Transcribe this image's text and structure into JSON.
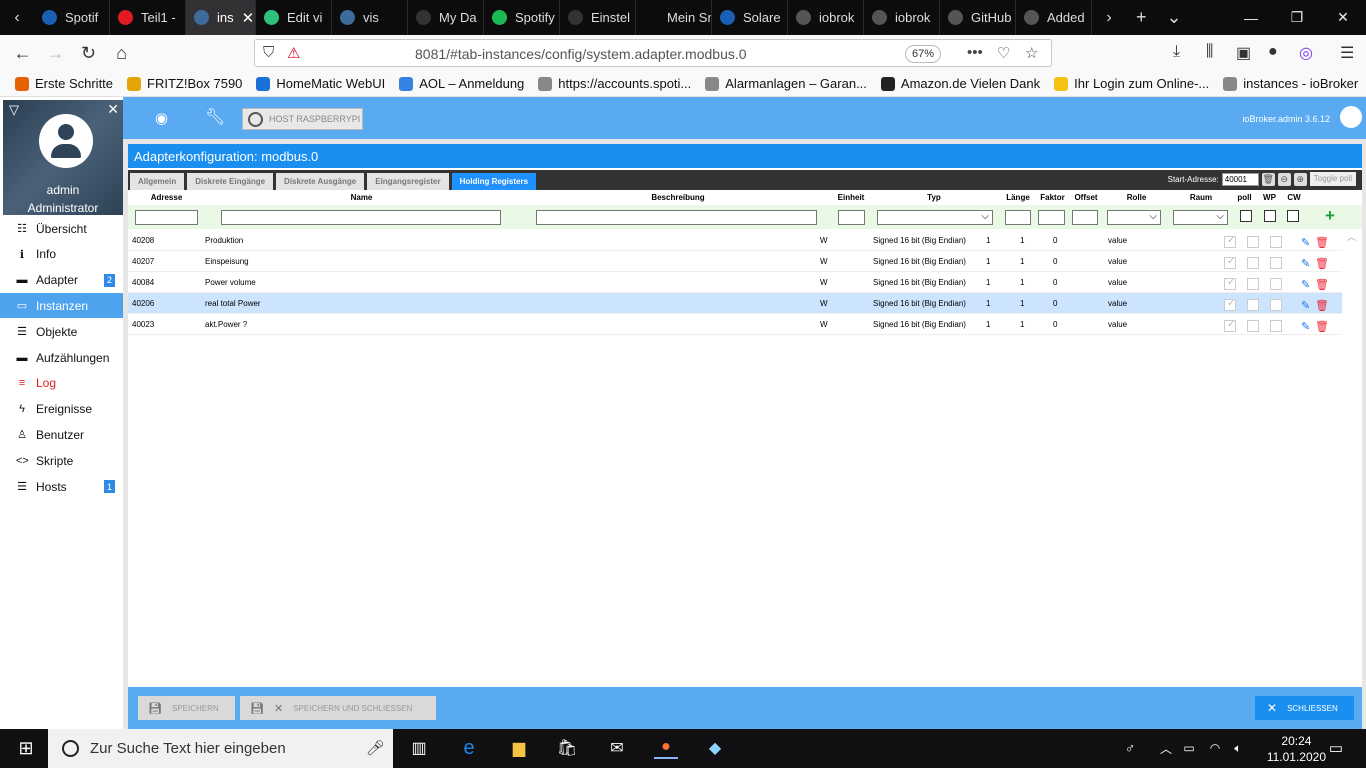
{
  "browser": {
    "tabs": [
      {
        "label": "Spotif",
        "color": "#1a5fb4"
      },
      {
        "label": "Teil1 -",
        "color": "#e01b24"
      },
      {
        "label": "ins",
        "color": "#3d6c9a",
        "active": true
      },
      {
        "label": "Edit vi",
        "color": "#2ec27e"
      },
      {
        "label": "vis",
        "color": "#3d6c9a"
      },
      {
        "label": "My Da",
        "color": "#333"
      },
      {
        "label": "Spotify",
        "color": "#1db954"
      },
      {
        "label": "Einstel",
        "color": "#333"
      },
      {
        "label": "Mein Smar",
        "color": "#0c0c0d"
      },
      {
        "label": "Solare",
        "color": "#1a5fb4"
      },
      {
        "label": "iobrok",
        "color": "#555"
      },
      {
        "label": "iobrok",
        "color": "#555"
      },
      {
        "label": "GitHub",
        "color": "#555"
      },
      {
        "label": "Added",
        "color": "#555"
      }
    ],
    "url": "8081/#tab-instances/config/system.adapter.modbus.0",
    "zoom": "67%",
    "bookmarks": [
      {
        "label": "Erste Schritte",
        "color": "#e66100"
      },
      {
        "label": "FRITZ!Box 7590",
        "color": "#e5a50a"
      },
      {
        "label": "HomeMatic WebUI",
        "color": "#1c71d8"
      },
      {
        "label": "AOL – Anmeldung",
        "color": "#3584e4"
      },
      {
        "label": "https://accounts.spoti...",
        "color": "#888"
      },
      {
        "label": "Alarmanlagen – Garan...",
        "color": "#888"
      },
      {
        "label": "Amazon.de Vielen Dank",
        "color": "#222"
      },
      {
        "label": "Ihr Login zum Online-...",
        "color": "#f5c211"
      },
      {
        "label": "instances - ioBroker",
        "color": "#888"
      }
    ]
  },
  "profile": {
    "name": "admin",
    "role": "Administrator"
  },
  "menu": [
    {
      "label": "Übersicht",
      "icon": "grid-icon",
      "glyph": "☷"
    },
    {
      "label": "Info",
      "icon": "info-icon",
      "glyph": "ℹ"
    },
    {
      "label": "Adapter",
      "icon": "store-icon",
      "glyph": "▬",
      "badge": "2"
    },
    {
      "label": "Instanzen",
      "icon": "instances-icon",
      "glyph": "▭",
      "selected": true
    },
    {
      "label": "Objekte",
      "icon": "list-icon",
      "glyph": "☰"
    },
    {
      "label": "Aufzählungen",
      "icon": "enum-icon",
      "glyph": "▬"
    },
    {
      "label": "Log",
      "icon": "log-icon",
      "glyph": "≡",
      "red": true
    },
    {
      "label": "Ereignisse",
      "icon": "bolt-icon",
      "glyph": "ϟ"
    },
    {
      "label": "Benutzer",
      "icon": "user-icon",
      "glyph": "♙"
    },
    {
      "label": "Skripte",
      "icon": "code-icon",
      "glyph": "<>"
    },
    {
      "label": "Hosts",
      "icon": "hosts-icon",
      "glyph": "☰",
      "badge": "1"
    }
  ],
  "topbar": {
    "host": "HOST RASPBERRYPI",
    "version": "ioBroker.admin 3.6.12"
  },
  "dialog": {
    "title": "Adapterkonfiguration: modbus.0",
    "tabs": [
      "Allgemein",
      "Diskrete Eingänge",
      "Diskrete Ausgänge",
      "Eingangsregister",
      "Holding Registers"
    ],
    "start_label": "Start-Adresse:",
    "start_value": "40001",
    "toggle_poll": "Toggle poll",
    "columns": [
      "Adresse",
      "Name",
      "Beschreibung",
      "Einheit",
      "Typ",
      "Länge",
      "Faktor",
      "Offset",
      "Rolle",
      "Raum",
      "poll",
      "WP",
      "CW"
    ],
    "rows": [
      {
        "address": "40208",
        "name": "Produktion",
        "unit": "W",
        "type": "Signed 16 bit (Big Endian)",
        "length": "1",
        "factor": "1",
        "offset": "0",
        "role": "value"
      },
      {
        "address": "40207",
        "name": "Einspeisung",
        "unit": "W",
        "type": "Signed 16 bit (Big Endian)",
        "length": "1",
        "factor": "1",
        "offset": "0",
        "role": "value"
      },
      {
        "address": "40084",
        "name": "Power volume",
        "unit": "W",
        "type": "Signed 16 bit (Big Endian)",
        "length": "1",
        "factor": "1",
        "offset": "0",
        "role": "value"
      },
      {
        "address": "40206",
        "name": "real total Power",
        "unit": "W",
        "type": "Signed 16 bit (Big Endian)",
        "length": "1",
        "factor": "1",
        "offset": "0",
        "role": "value",
        "highlight": true
      },
      {
        "address": "40023",
        "name": "akt.Power ?",
        "unit": "W",
        "type": "Signed 16 bit (Big Endian)",
        "length": "1",
        "factor": "1",
        "offset": "0",
        "role": "value"
      }
    ],
    "save": "SPEICHERN",
    "save_close": "SPEICHERN UND SCHLIESSEN",
    "close": "SCHLIESSEN"
  },
  "taskbar": {
    "search": "Zur Suche Text hier eingeben",
    "time": "20:24",
    "date": "11.01.2020"
  }
}
